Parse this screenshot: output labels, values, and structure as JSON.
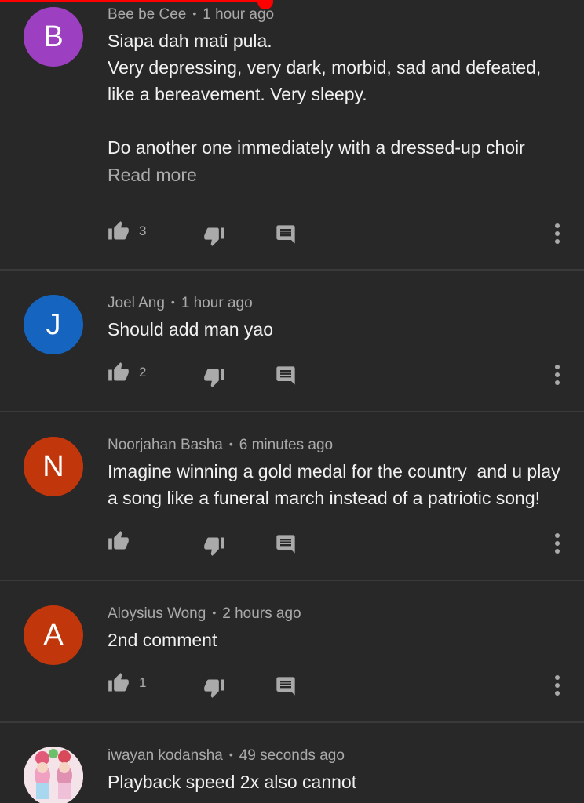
{
  "colors": {
    "background": "#282828",
    "accent_red": "#ff0000",
    "text_primary": "#f1f1f1",
    "text_secondary": "#aaaaaa"
  },
  "meta_separator": "•",
  "comments": [
    {
      "author": "Bee be Cee",
      "time": "1 hour ago",
      "avatar_letter": "B",
      "avatar_color": "#9c3fc0",
      "text": "Siapa dah mati pula.\nVery depressing, very dark, morbid, sad and defeated, like a bereavement. Very sleepy.\n\nDo another one immediately with a dressed-up choir",
      "read_more": "Read more",
      "likes": "3"
    },
    {
      "author": "Joel Ang",
      "time": "1 hour ago",
      "avatar_letter": "J",
      "avatar_color": "#1565c0",
      "text": "Should add man yao",
      "likes": "2"
    },
    {
      "author": "Noorjahan Basha",
      "time": "6 minutes ago",
      "avatar_letter": "N",
      "avatar_color": "#c2360c",
      "text": "Imagine winning a gold medal for the country  and u play a song like a funeral march instead of a patriotic song!",
      "likes": ""
    },
    {
      "author": "Aloysius Wong",
      "time": "2 hours ago",
      "avatar_letter": "A",
      "avatar_color": "#c2360c",
      "text": "2nd comment",
      "likes": "1"
    },
    {
      "author": "iwayan kodansha",
      "time": "49 seconds ago",
      "avatar_icon": "photo-avatar",
      "text": "Playback speed 2x also cannot"
    }
  ],
  "icons": {
    "like": "thumbs-up-icon",
    "dislike": "thumbs-down-icon",
    "reply": "comment-reply-icon",
    "more": "more-vertical-icon"
  }
}
